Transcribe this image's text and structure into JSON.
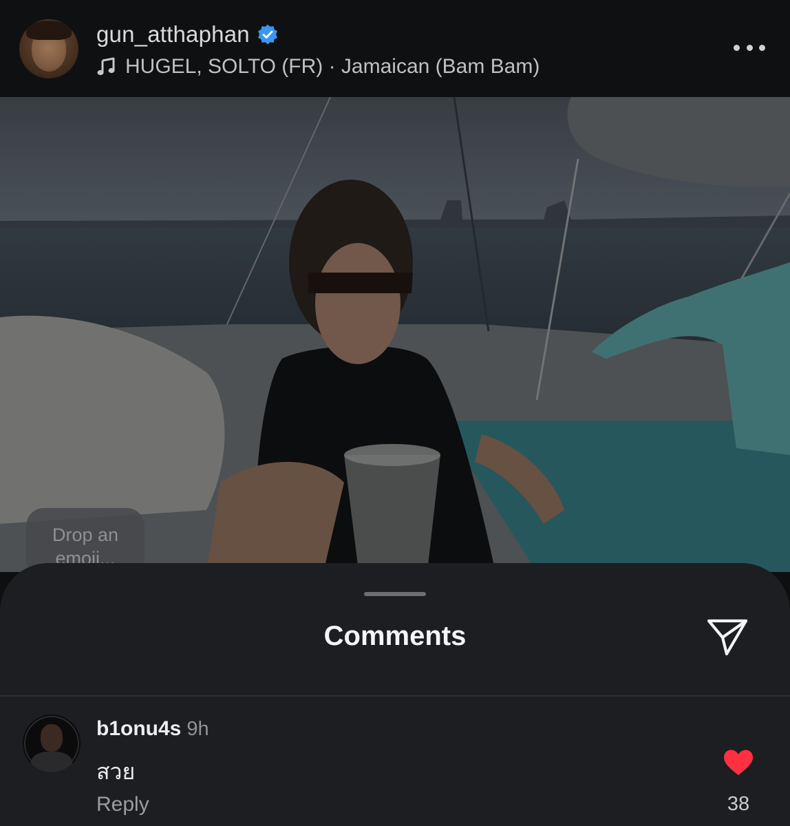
{
  "post": {
    "username": "gun_atthaphan",
    "music": "HUGEL, SOLTO (FR) · Jamaican (Bam Bam)",
    "verified_color": "#3897f0"
  },
  "photo": {
    "emoji_prompt": "Drop an emoji..."
  },
  "comments_sheet": {
    "title": "Comments",
    "comments": [
      {
        "username": "b1onu4s",
        "time": "9h",
        "text": "สวย",
        "reply_label": "Reply",
        "likes": "38",
        "like_color": "#ff3040"
      }
    ]
  }
}
